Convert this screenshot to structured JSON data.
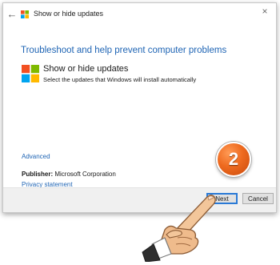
{
  "window": {
    "title": "Show or hide updates",
    "close_glyph": "×",
    "back_glyph": "←"
  },
  "heading": "Troubleshoot and help prevent computer problems",
  "item": {
    "title": "Show or hide updates",
    "description": "Select the updates that Windows will install automatically",
    "icon": "windows-logo-icon"
  },
  "advanced_link": "Advanced",
  "publisher": {
    "label": "Publisher:",
    "value": "Microsoft Corporation"
  },
  "privacy_link": "Privacy statement",
  "buttons": {
    "next": "Next",
    "cancel": "Cancel"
  },
  "step_badge": "2",
  "colors": {
    "link": "#1e64b4",
    "logo_red": "#f25022",
    "logo_green": "#7fba00",
    "logo_blue": "#00a4ef",
    "logo_yellow": "#ffb900",
    "badge": "#ee6a1f"
  }
}
